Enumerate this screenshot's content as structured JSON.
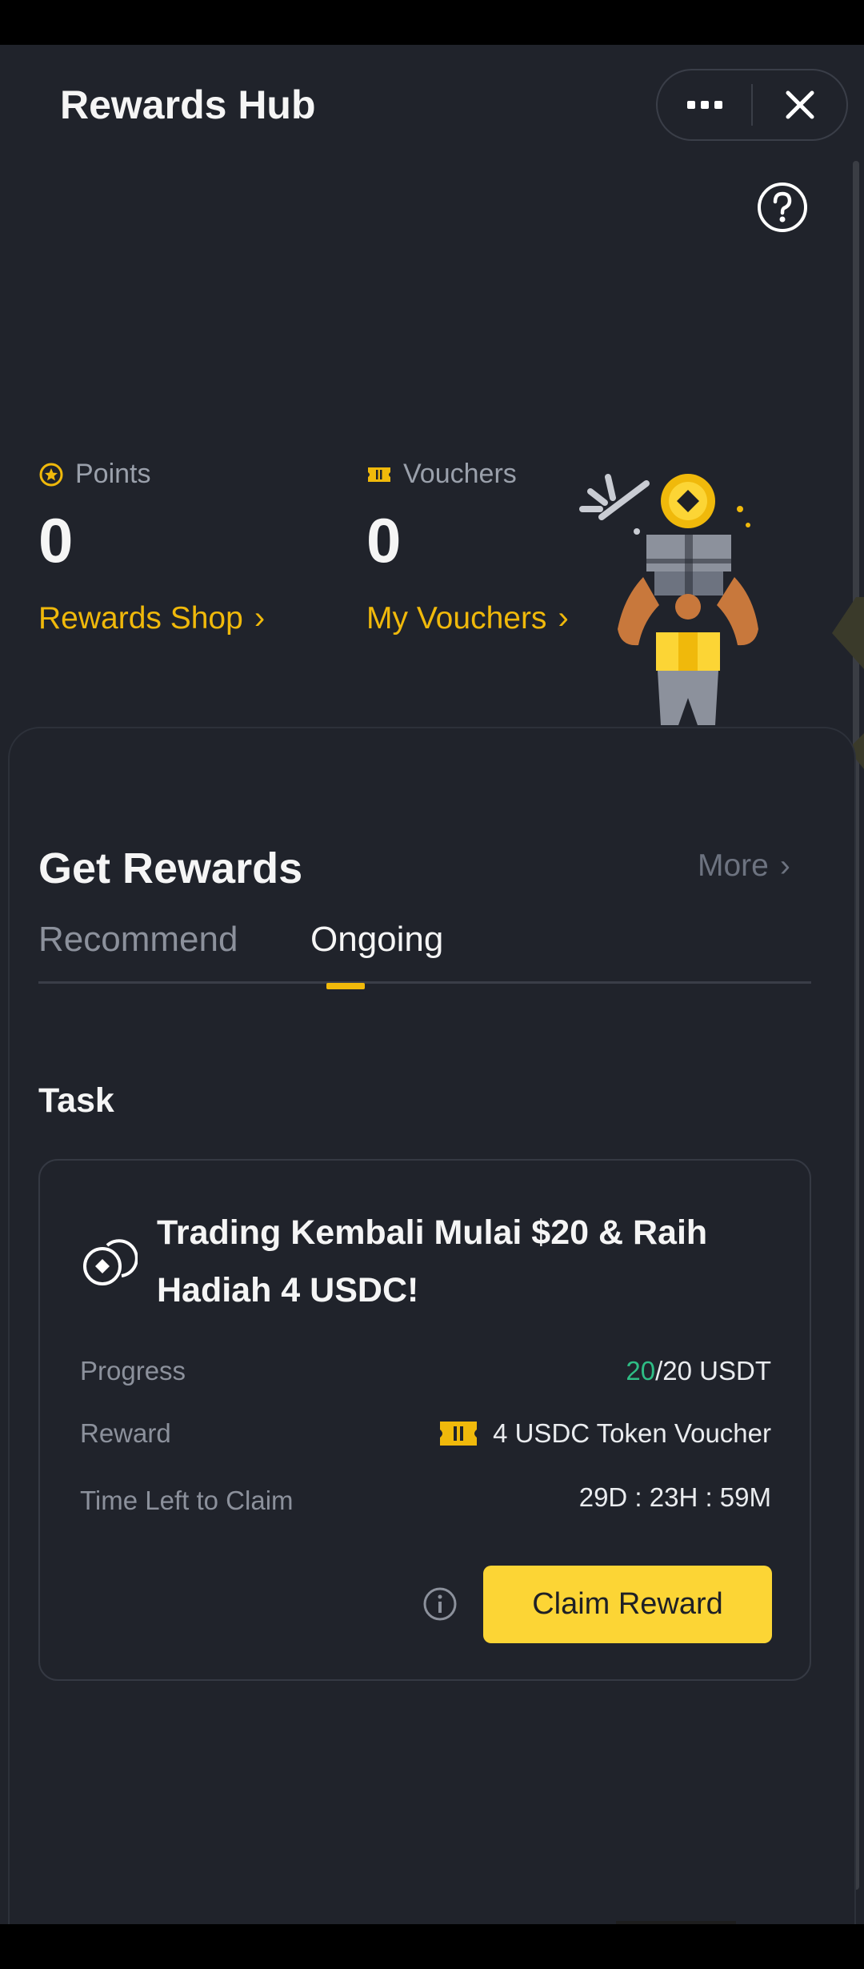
{
  "header": {
    "title": "Rewards Hub",
    "more_icon": "more-horizontal-icon",
    "close_icon": "close-icon",
    "help_icon": "question-circle-icon"
  },
  "stats": {
    "points": {
      "label": "Points",
      "value": "0",
      "link": "Rewards Shop",
      "icon": "star-coin-icon"
    },
    "vouchers": {
      "label": "Vouchers",
      "value": "0",
      "link": "My Vouchers",
      "icon": "ticket-icon"
    }
  },
  "get_rewards": {
    "title": "Get Rewards",
    "more_label": "More",
    "tabs": [
      {
        "label": "Recommend",
        "active": false
      },
      {
        "label": "Ongoing",
        "active": true
      }
    ]
  },
  "task_section": {
    "heading": "Task",
    "card": {
      "title": "Trading Kembali Mulai $20 & Raih Hadiah 4 USDC!",
      "progress_label": "Progress",
      "progress_current": "20",
      "progress_total": "/20 USDT",
      "reward_label": "Reward",
      "reward_value": "4 USDC Token Voucher",
      "time_label": "Time Left to Claim",
      "time_value": "29D : 23H : 59M",
      "claim_label": "Claim Reward"
    }
  },
  "colors": {
    "background": "#20232b",
    "accent": "#f0b90b",
    "button": "#fcd535",
    "positive": "#2ebd85",
    "muted": "#8c919c"
  }
}
